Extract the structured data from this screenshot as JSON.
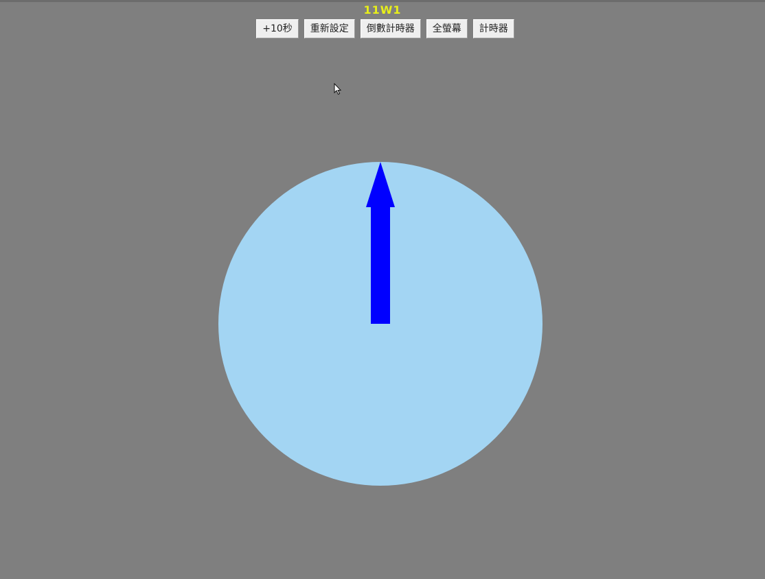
{
  "title": "11W1",
  "toolbar": {
    "buttons": [
      {
        "label": "+10秒"
      },
      {
        "label": "重新設定"
      },
      {
        "label": "倒數計時器"
      },
      {
        "label": "全螢幕"
      },
      {
        "label": "計時器"
      }
    ]
  },
  "dial": {
    "progress": 0,
    "face_color": "#a3d5f3",
    "hand_color": "#0000ff"
  },
  "colors": {
    "background": "#7f7f7f",
    "title": "#e8ef1a"
  },
  "icons": [
    "mouse-pointer-icon"
  ]
}
